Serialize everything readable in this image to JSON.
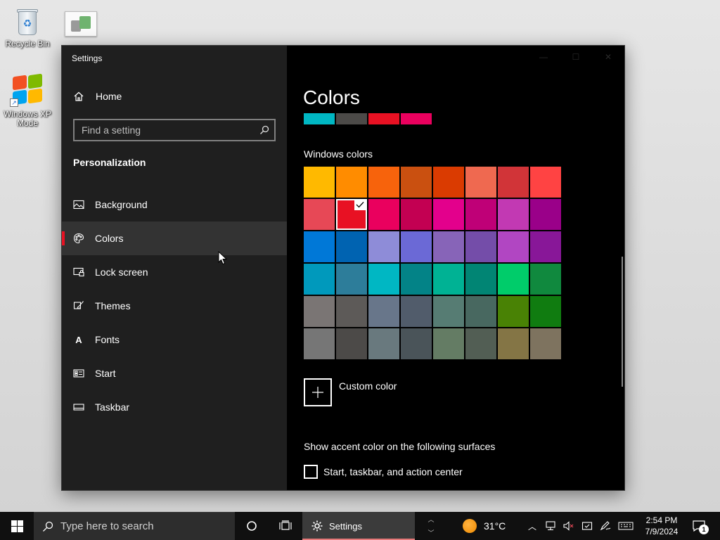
{
  "desktop": {
    "icons": [
      {
        "label": "Recycle Bin",
        "icon": "recycle-bin-icon"
      },
      {
        "label": "Windows XP Mode",
        "icon": "windows-xp-mode-icon"
      }
    ]
  },
  "window": {
    "title": "Settings",
    "sidebar": {
      "home_label": "Home",
      "search_placeholder": "Find a setting",
      "section": "Personalization",
      "items": [
        {
          "label": "Background",
          "icon": "image-icon"
        },
        {
          "label": "Colors",
          "icon": "palette-icon",
          "selected": true
        },
        {
          "label": "Lock screen",
          "icon": "lock-screen-icon"
        },
        {
          "label": "Themes",
          "icon": "brush-icon"
        },
        {
          "label": "Fonts",
          "icon": "fonts-icon"
        },
        {
          "label": "Start",
          "icon": "start-icon"
        },
        {
          "label": "Taskbar",
          "icon": "taskbar-icon"
        }
      ]
    },
    "main": {
      "title": "Colors",
      "preview_colors": [
        "#00b7c3",
        "#4c4a48",
        "#e81123",
        "#ea005e"
      ],
      "windows_colors_label": "Windows colors",
      "swatches": [
        [
          "#ffb900",
          "#ff8c00",
          "#f7630c",
          "#ca5010",
          "#da3b01",
          "#ef6950",
          "#d13438",
          "#ff4343"
        ],
        [
          "#e74856",
          "#e81123",
          "#ea005e",
          "#c30052",
          "#e3008c",
          "#bf0077",
          "#c239b3",
          "#9a0089"
        ],
        [
          "#0078d7",
          "#0063b1",
          "#8e8cd8",
          "#6b69d6",
          "#8764b8",
          "#744da9",
          "#b146c2",
          "#881798"
        ],
        [
          "#0099bc",
          "#2d7d9a",
          "#00b7c3",
          "#038387",
          "#00b294",
          "#018574",
          "#00cc6a",
          "#10893e"
        ],
        [
          "#7a7574",
          "#5d5a58",
          "#68768a",
          "#515c6b",
          "#567c73",
          "#486860",
          "#498205",
          "#107c10"
        ],
        [
          "#767676",
          "#4c4a48",
          "#69797e",
          "#4a5459",
          "#647c64",
          "#525e54",
          "#847545",
          "#7e735f"
        ]
      ],
      "selected_swatch": {
        "row": 1,
        "col": 1
      },
      "custom_color_label": "Custom color",
      "surfaces_label": "Show accent color on the following surfaces",
      "checkbox_label": "Start, taskbar, and action center",
      "checkbox_checked": false
    }
  },
  "taskbar": {
    "search_placeholder": "Type here to search",
    "app_label": "Settings",
    "temperature": "31°C",
    "time": "2:54 PM",
    "date": "7/9/2024",
    "notification_count": "1"
  }
}
